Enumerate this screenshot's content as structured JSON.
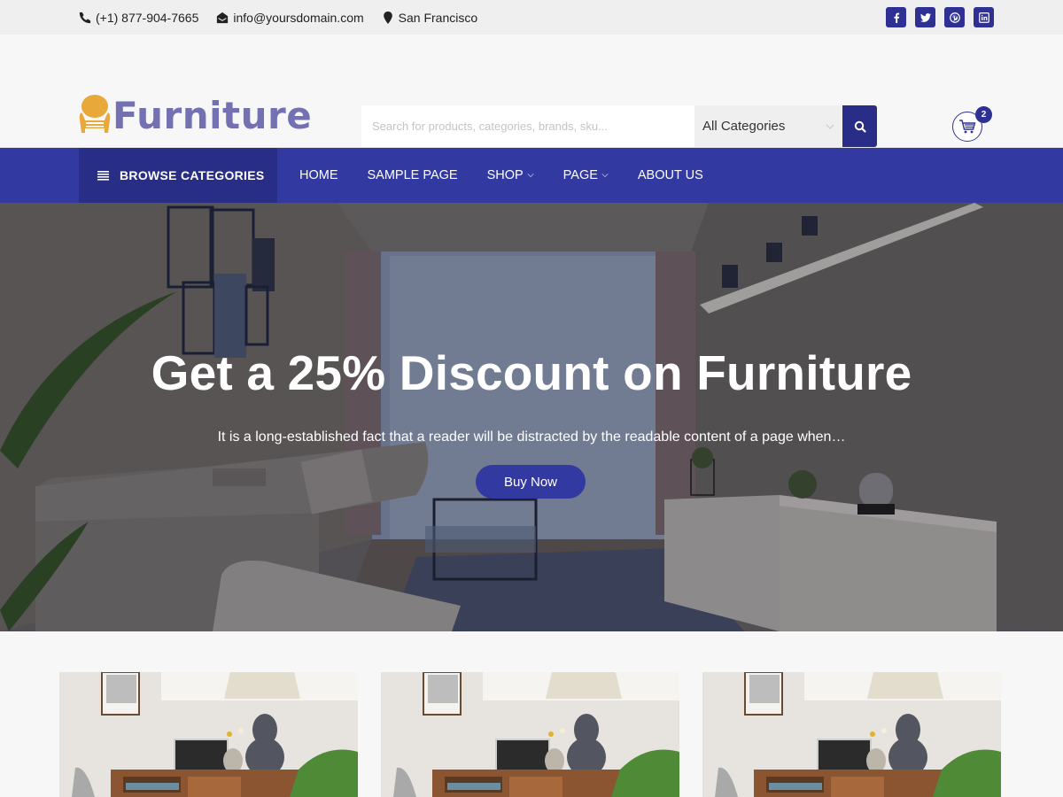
{
  "topbar": {
    "phone": "(+1) 877-904-7665",
    "email": "info@yoursdomain.com",
    "location": "San Francisco",
    "socials": [
      {
        "name": "facebook",
        "glyph": "f"
      },
      {
        "name": "twitter",
        "glyph": "t"
      },
      {
        "name": "pinterest",
        "glyph": "p"
      },
      {
        "name": "linkedin",
        "glyph": "in"
      }
    ]
  },
  "header": {
    "logo_text": "Furniture",
    "search": {
      "placeholder": "Search for products, categories, brands, sku...",
      "value": "",
      "category_selected": "All Categories"
    },
    "cart": {
      "count": "2"
    }
  },
  "nav": {
    "browse_label": "BROWSE CATEGORIES",
    "items": [
      {
        "label": "HOME",
        "has_dropdown": false
      },
      {
        "label": "SAMPLE PAGE",
        "has_dropdown": false
      },
      {
        "label": "SHOP",
        "has_dropdown": true
      },
      {
        "label": "PAGE",
        "has_dropdown": true
      },
      {
        "label": "ABOUT US",
        "has_dropdown": false
      }
    ]
  },
  "hero": {
    "title": "Get a 25% Discount on Furniture",
    "subtitle": "It is a long-established fact that a reader will be distracted by the readable content of a page when…",
    "button_label": "Buy Now"
  },
  "colors": {
    "brand": "#2e3193",
    "nav_bg": "#3239a0",
    "browse_bg": "#282e86",
    "logo_text": "#7471b3",
    "logo_chair": "#e8a93a"
  },
  "products": [
    {
      "image": "desk-with-laptop-lamp-plant"
    },
    {
      "image": "desk-with-laptop-lamp-plant"
    },
    {
      "image": "desk-with-laptop-lamp-plant"
    }
  ]
}
